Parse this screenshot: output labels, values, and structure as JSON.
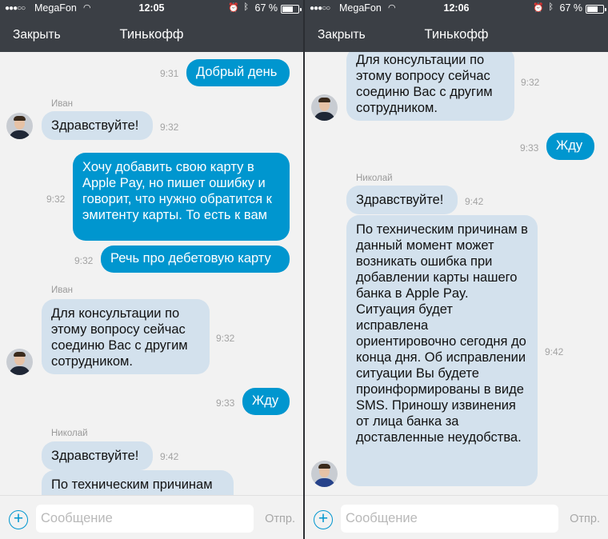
{
  "status_bar": {
    "left": {
      "signal_dots": "●●●○○",
      "carrier": "MegaFon",
      "time": "12:05",
      "battery_percent": "67 %"
    },
    "right": {
      "signal_dots": "●●●○○",
      "carrier": "MegaFon",
      "time": "12:06",
      "battery_percent": "67 %"
    }
  },
  "header": {
    "close_label": "Закрыть",
    "title": "Тинькофф"
  },
  "input": {
    "placeholder": "Сообщение",
    "send_label": "Отпр.",
    "add_icon": "plus-circle-icon"
  },
  "colors": {
    "incoming_bubble": "#d3e1ed",
    "outgoing_bubble": "#0096cf",
    "header_bg": "#3b3f45"
  },
  "left_chat": {
    "messages": [
      {
        "text": "Добрый день",
        "time": "9:31"
      },
      {
        "sender": "Иван",
        "text": "Здравствуйте!",
        "time": "9:32"
      },
      {
        "text": "Хочу добавить свою карту в Apple Pay, но пишет ошибку и говорит, что нужно обратится к эмитенту карты. То есть к вам",
        "time": "9:32"
      },
      {
        "text": "Речь про дебетовую карту",
        "time": "9:32"
      },
      {
        "sender": "Иван",
        "text": "Для консультации по этому вопросу сейчас соединю Вас с другим сотрудником.",
        "time": "9:32"
      },
      {
        "text": "Жду",
        "time": "9:33"
      },
      {
        "sender": "Николай",
        "text": "Здравствуйте!",
        "time": "9:42"
      },
      {
        "text": "По техническим причинам"
      }
    ]
  },
  "right_chat": {
    "messages": [
      {
        "text": "Для консультации по этому вопросу сейчас соединю Вас с другим сотрудником.",
        "time": "9:32"
      },
      {
        "text": "Жду",
        "time": "9:33"
      },
      {
        "sender": "Николай",
        "text": "Здравствуйте!",
        "time": "9:42"
      },
      {
        "text": "По техническим причинам в данный момент может возникать ошибка при добавлении карты нашего банка в Apple Pay. Ситуация будет исправлена ориентировочно сегодня до конца дня. Об исправлении ситуации Вы будете проинформированы в виде SMS. Приношу извинения от лица банка за доставленные неудобства.",
        "time": "9:42"
      }
    ]
  }
}
